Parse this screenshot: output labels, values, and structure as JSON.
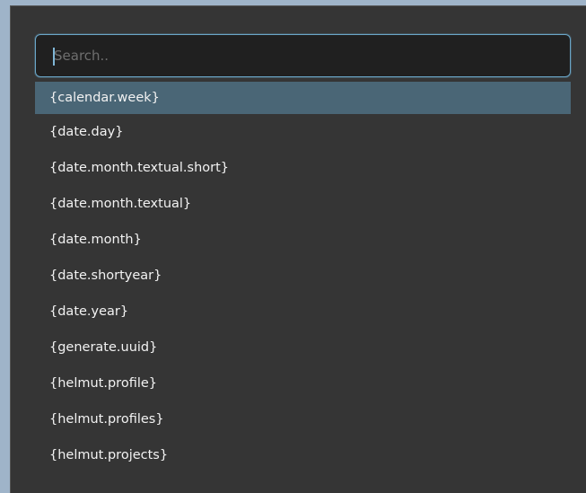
{
  "search": {
    "placeholder": "Search..",
    "value": ""
  },
  "suggestions": {
    "selected_index": 0,
    "items": [
      "{calendar.week}",
      "{date.day}",
      "{date.month.textual.short}",
      "{date.month.textual}",
      "{date.month}",
      "{date.shortyear}",
      "{date.year}",
      "{generate.uuid}",
      "{helmut.profile}",
      "{helmut.profiles}",
      "{helmut.projects}"
    ]
  },
  "colors": {
    "panel_background": "#353535",
    "input_border": "#6aa6c8",
    "selected_row": "#4a6676",
    "text": "#f2f2f2"
  }
}
